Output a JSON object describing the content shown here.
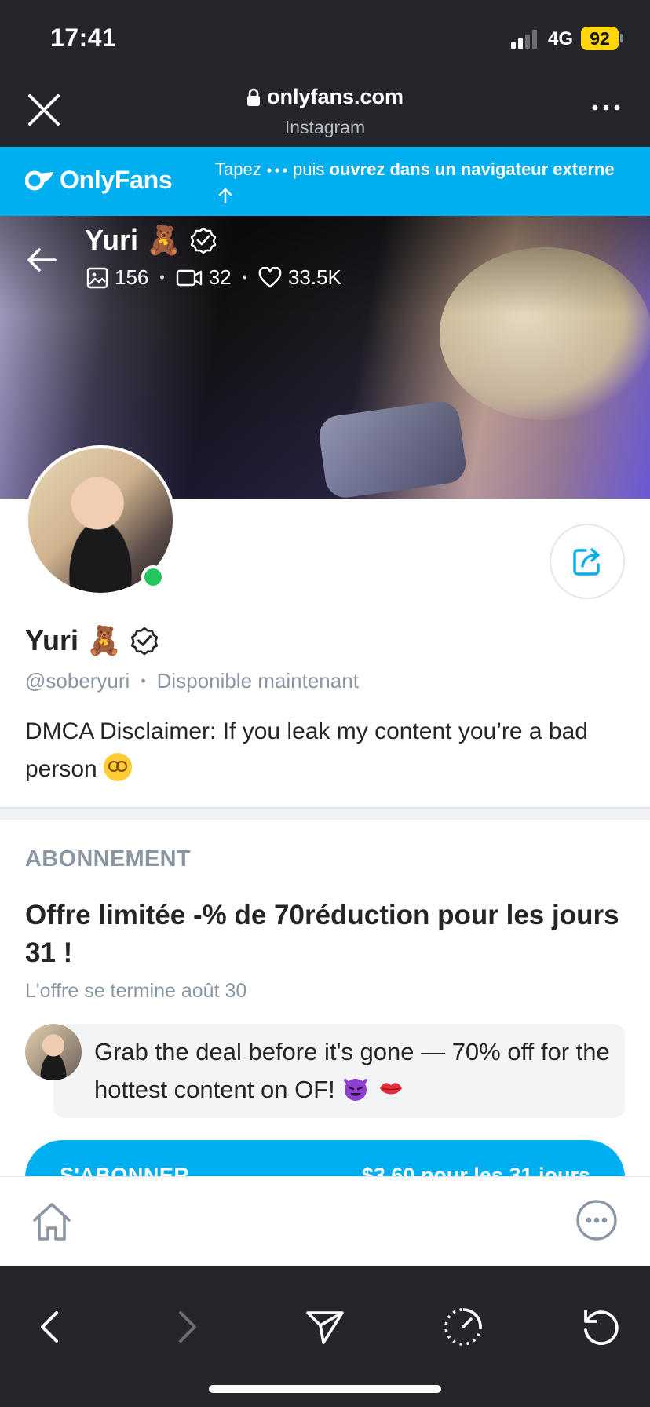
{
  "status_bar": {
    "time": "17:41",
    "network": "4G",
    "battery": "92"
  },
  "browser": {
    "domain": "onlyfans.com",
    "source": "Instagram"
  },
  "banner": {
    "brand": "OnlyFans",
    "hint_prefix": "Tapez",
    "hint_middle": "puis",
    "hint_bold": "ouvrez dans un navigateur externe"
  },
  "cover": {
    "name": "Yuri",
    "name_emoji": "🧸",
    "stats": {
      "photos": "156",
      "videos": "32",
      "likes": "33.5K"
    }
  },
  "profile": {
    "name": "Yuri",
    "name_emoji": "🧸",
    "handle": "@soberyuri",
    "status": "Disponible maintenant",
    "bio": "DMCA Disclaimer: If you leak my content you’re a bad person"
  },
  "subscription": {
    "section_title": "ABONNEMENT",
    "offer": "Offre limitée -% de 70réduction pour les jours 31 !",
    "ends": "L'offre se termine août 30",
    "message": "Grab the deal before it's gone — 70% off for the hottest content on OF!",
    "button_label": "S'ABONNER",
    "button_price": "$3.60 pour les 31 jours"
  },
  "colors": {
    "brand": "#00aff0",
    "online": "#22c55e",
    "dark_chrome": "#24262b",
    "muted": "#8a96a3",
    "battery": "#ffd60a"
  },
  "icons": [
    "close-icon",
    "lock-icon",
    "more-dots-icon",
    "onlyfans-logo-icon",
    "back-arrow-icon",
    "verified-icon",
    "image-icon",
    "video-icon",
    "heart-icon",
    "share-icon",
    "home-icon",
    "chat-dots-icon",
    "browser-back-icon",
    "browser-forward-icon",
    "send-icon",
    "timer-icon",
    "reload-icon"
  ]
}
